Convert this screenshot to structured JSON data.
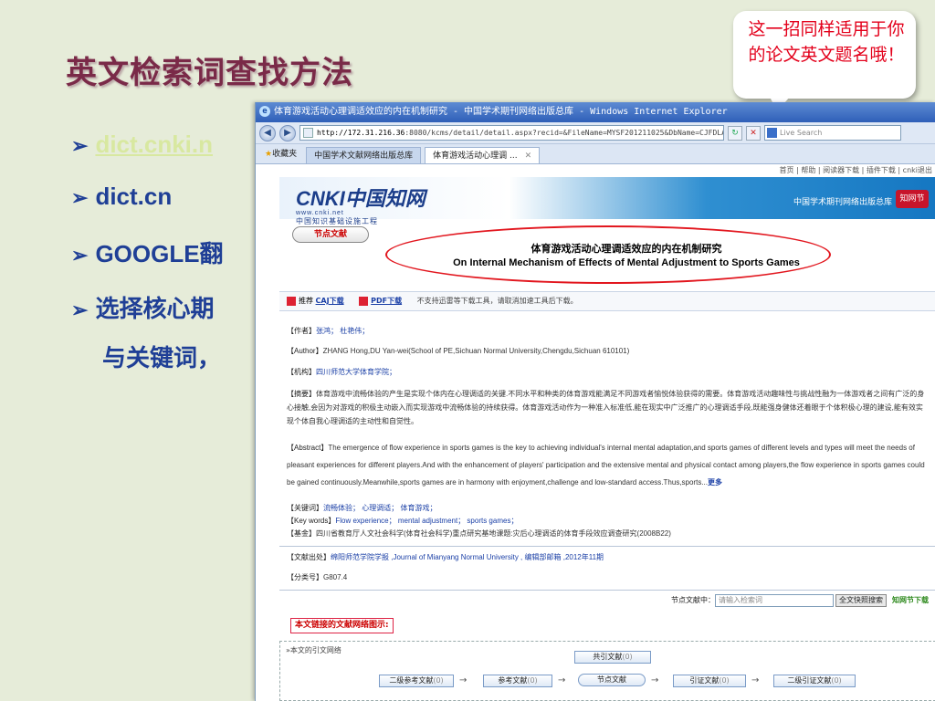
{
  "slide": {
    "title": "英文检索词查找方法",
    "bullet_marker": "➢",
    "bullets": [
      "dict.cnki.n",
      "dict.cn",
      "GOOGLE翻",
      "选择核心期",
      "与关键词，"
    ],
    "callout": "这一招同样适用于你的论文英文题名哦！"
  },
  "browser": {
    "window_title": "体育游戏活动心理调适效应的内在机制研究 - 中国学术期刊网络出版总库 - Windows Internet Explorer",
    "address_host": "http://172.31.216.36",
    "address_path": ":8080/kcms/detail/detail.aspx?recid=&FileName=MYSF201211025&DbName=CJFDLAST20",
    "search_placeholder": "Live Search",
    "favorites_label": "收藏夹",
    "tabs": [
      "中国学术文献网络出版总库",
      "体育游戏活动心理调 ..."
    ]
  },
  "cnki": {
    "top_links": "首页 | 帮助 | 阅读器下载 | 插件下载 | cnki退出",
    "logo_main": "CNKI中国知网",
    "logo_url": "www.cnki.net",
    "logo_cn": "中国知识基础设施工程",
    "publisher": "中国学术期刊网络出版总库",
    "publisher_badge": "知网节",
    "node_tag": "节点文献",
    "title_cn": "体育游戏活动心理调适效应的内在机制研究",
    "title_en": "On Internal Mechanism of Effects of Mental Adjustment to Sports Games",
    "download": {
      "recommend": "推荐",
      "caj": "CAJ下载",
      "pdf": "PDF下载",
      "note": "不支持迅雷等下载工具，请取消加速工具后下载。"
    },
    "author_label": "【作者】",
    "author_value": "张鸿； 杜艳伟；",
    "eauthor_label": "【Author】",
    "eauthor_value": "ZHANG Hong,DU Yan-wei(School of PE,Sichuan Normal University,Chengdu,Sichuan 610101)",
    "inst_label": "【机构】",
    "inst_value": "四川师范大学体育学院；",
    "abs_label": "【摘要】",
    "abs_value": "体育游戏中流畅体验的产生是实现个体内在心理调适的关键.不同水平和种类的体育游戏能满足不同游戏者愉悦体验获得的需要。体育游戏活动趣味性与挑战性融为一体游戏者之间有广泛的身心接触,会因为对游戏的积极主动嵌入而实现游戏中流畅体验的持续获得。体育游戏活动作为一种准入标准低,能在现实中广泛推广的心理调适手段,既能强身健体还着眼于个体积极心理的建设,能有效实现个体自我心理调适的主动性和自觉性。",
    "eabs_label": "【Abstract】",
    "eabs_value": "The emergence of flow experience in sports games is the key to achieving individual's internal mental adaptation,and sports games of different levels and types will meet the needs of pleasant experiences for different players.And with the enhancement of players' participation and the extensive mental and physical contact among players,the flow experience in sports games could be gained continuously.Meanwhile,sports games are in harmony with enjoyment,challenge and low-standard access.Thus,sports...",
    "more": "更多",
    "kw_label": "【关键词】",
    "kw_value": "流畅体验； 心理调适； 体育游戏；",
    "ekw_label": "【Key words】",
    "ekw_value": "Flow experience； mental adjustment； sports games；",
    "fund_label": "【基金】",
    "fund_value": "四川省教育厅人文社会科学(体育社会科学)重点研究基地课题:灾后心理调适的体育手段效应调查研究(2008B22)",
    "src_label": "【文献出处】",
    "src_value": "绵阳师范学院学报 ,Journal of Mianyang Normal University , 编辑部邮箱 ,2012年11期",
    "cls_label": "【分类号】",
    "cls_value": "G807.4",
    "search_label": "节点文献中：",
    "search_placeholder": "请输入检索词",
    "search_button": "全文快照搜索",
    "know_next": "知网节下载",
    "network_title": "本文链接的文献网络图示:",
    "network_label": "»本文的引文网络",
    "network": {
      "common_cited": "共引文献",
      "common_cited_count": "(0)",
      "second_refs": "二级参考文献",
      "second_refs_count": "(0)",
      "refs": "参考文献",
      "refs_count": "(0)",
      "node": "节点文献",
      "citing": "引证文献",
      "citing_count": "(0)",
      "second_citing": "二级引证文献",
      "second_citing_count": "(0)"
    }
  }
}
